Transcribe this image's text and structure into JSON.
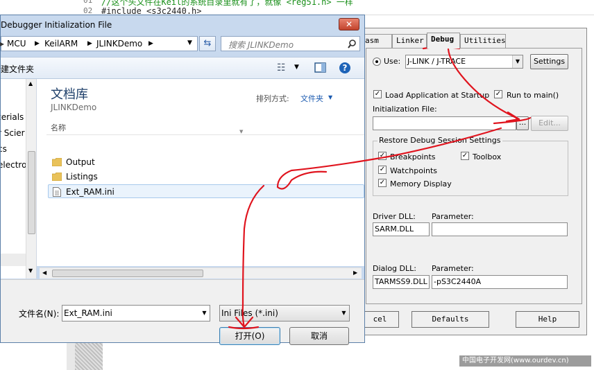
{
  "editor": {
    "lines": [
      "//这个头文件在Keil的系统目录里就有了，就像 <reg51.h>  一样",
      "#include <s3c2440.h>"
    ],
    "line_numbers": [
      "01",
      "02"
    ]
  },
  "file_dialog": {
    "title": "Debugger Initialization File",
    "breadcrumb": [
      "MCU",
      "KeilARM",
      "JLINKDemo"
    ],
    "search_placeholder": "搜索 JLINKDemo",
    "new_folder_label": "新建文件夹",
    "nav_items": [
      "terials",
      "r Scier",
      "cs",
      "electro"
    ],
    "library_title": "文档库",
    "library_subtitle": "JLINKDemo",
    "sort_label": "排列方式:",
    "sort_value": "文件夹",
    "column_name": "名称",
    "files": [
      {
        "name": "Output",
        "type": "folder"
      },
      {
        "name": "Listings",
        "type": "folder"
      },
      {
        "name": "Ext_RAM.ini",
        "type": "file",
        "selected": true
      }
    ],
    "filename_label": "文件名(N):",
    "filename_value": "Ext_RAM.ini",
    "filter_value": "Ini Files (*.ini)",
    "open_button": "打开(O)",
    "cancel_button": "取消"
  },
  "options_dialog": {
    "tabs": [
      "asm",
      "Linker",
      "Debug",
      "Utilities"
    ],
    "active_tab": "Debug",
    "use_label": "Use:",
    "debugger_value": "J-LINK / J-TRACE",
    "settings_button": "Settings",
    "load_app_label": "Load Application at Startup",
    "run_to_main_label": "Run to main()",
    "init_file_label": "Initialization File:",
    "init_file_value": "",
    "browse_button": "...",
    "edit_button": "Edit...",
    "restore_group": "Restore Debug Session Settings",
    "restore_items": [
      "Breakpoints",
      "Toolbox",
      "Watchpoints",
      "Memory Display"
    ],
    "driver_dll_label": "Driver DLL:",
    "driver_dll_value": "SARM.DLL",
    "driver_param_label": "Parameter:",
    "driver_param_value": "",
    "dialog_dll_label": "Dialog DLL:",
    "dialog_dll_value": "TARMSS9.DLL",
    "dialog_param_label": "Parameter:",
    "dialog_param_value": "-pS3C2440A",
    "bottom_buttons": [
      "cel",
      "Defaults",
      "Help"
    ]
  },
  "watermark": "中国电子开发网(www.ourdev.cn)",
  "colors": {
    "annotation_red": "#e0141e",
    "title_bg": "#c8d9ee",
    "close_red": "#c2432c"
  }
}
